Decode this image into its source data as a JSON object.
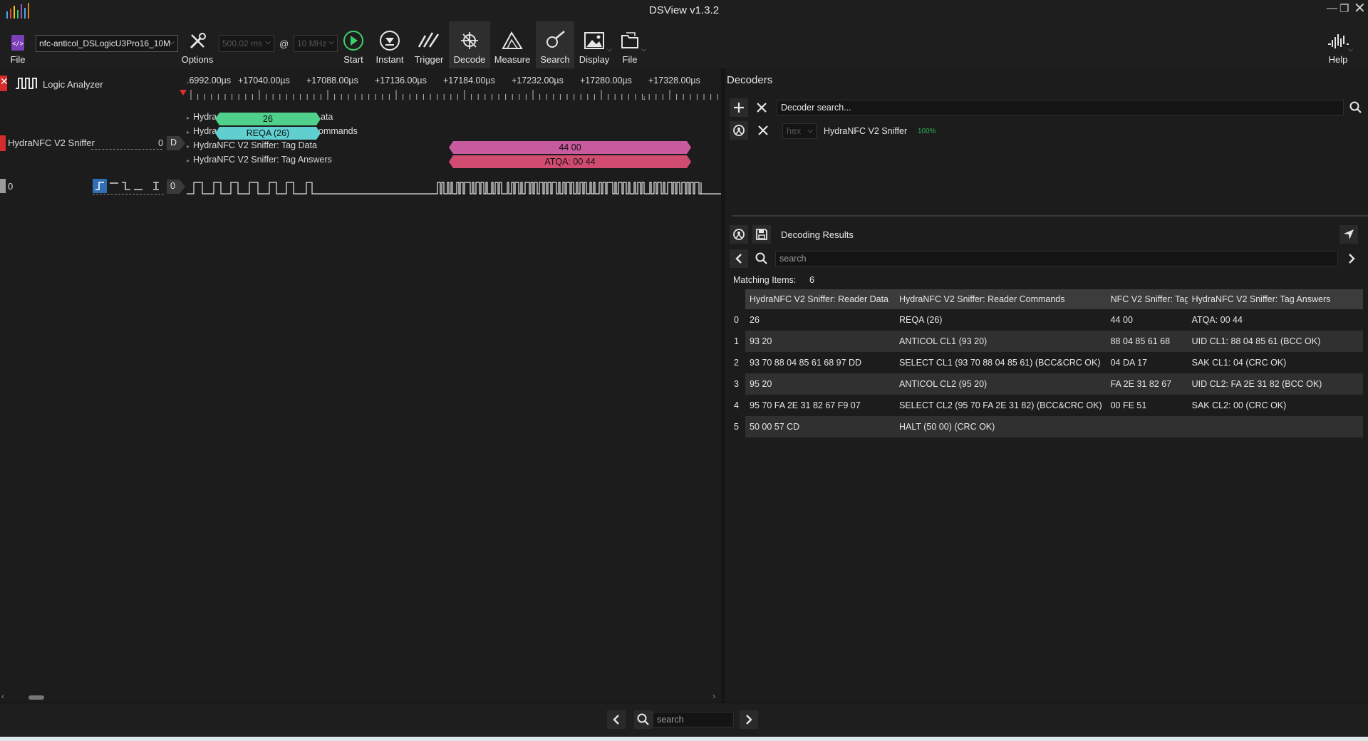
{
  "window": {
    "title": "DSView v1.3.2"
  },
  "toolbar": {
    "file_left_label": "File",
    "device_select": "nfc-anticol_DSLogicU3Pro16_10M",
    "options_label": "Options",
    "duration_select": "500.02 ms",
    "at_symbol": "@",
    "rate_select": "10 MHz",
    "start_label": "Start",
    "instant_label": "Instant",
    "trigger_label": "Trigger",
    "decode_label": "Decode",
    "measure_label": "Measure",
    "search_label": "Search",
    "display_label": "Display",
    "file_right_label": "File",
    "help_label": "Help"
  },
  "waveform": {
    "mode_label": "Logic Analyzer",
    "ruler_ticks": [
      ".6992.00µs",
      "+17040.00µs",
      "+17088.00µs",
      "+17136.00µs",
      "+17184.00µs",
      "+17232.00µs",
      "+17280.00µs",
      "+17328.00µs"
    ],
    "decoder_channel_label": "HydraNFC V2 Sniffer",
    "decoder_channel_index": "0",
    "decoder_badge": "D",
    "row_labels": {
      "reader_data_prefix": "Hydra",
      "reader_data_suffix": "ata",
      "reader_commands_prefix": "Hydra",
      "reader_commands_suffix": "ommands",
      "tag_data": "HydraNFC V2 Sniffer: Tag Data",
      "tag_answers": "HydraNFC V2 Sniffer: Tag Answers"
    },
    "annotations": {
      "reader_data": "26",
      "reader_command": "REQA (26)",
      "tag_data": "44 00",
      "tag_answer": "ATQA: 00 44"
    },
    "logic_channel_index": "0",
    "logic_channel_badge": "0",
    "colors": {
      "reader_data": "#4fd18b",
      "reader_command": "#5fcfcf",
      "tag_data": "#c85a9e",
      "tag_answer": "#d24c72"
    }
  },
  "decoders": {
    "title": "Decoders",
    "search_placeholder": "Decoder search...",
    "format_select": "hex",
    "decoder_name": "HydraNFC V2 Sniffer",
    "decoder_progress": "100%"
  },
  "results": {
    "title": "Decoding Results",
    "search_placeholder": "search",
    "matching_label": "Matching Items:",
    "matching_count": "6",
    "columns": [
      "HydraNFC V2 Sniffer: Reader Data",
      "HydraNFC V2 Sniffer: Reader Commands",
      "NFC V2 Sniffer: Tag",
      "HydraNFC V2 Sniffer: Tag Answers"
    ],
    "rows": [
      {
        "idx": "0",
        "reader_data": "26",
        "reader_cmd": "REQA (26)",
        "tag_data": "44 00",
        "tag_answer": "ATQA: 00 44"
      },
      {
        "idx": "1",
        "reader_data": "93 20",
        "reader_cmd": "ANTICOL CL1 (93 20)",
        "tag_data": "88 04 85 61 68",
        "tag_answer": "UID CL1: 88 04 85 61 (BCC OK)"
      },
      {
        "idx": "2",
        "reader_data": "93 70 88 04 85 61 68 97 DD",
        "reader_cmd": "SELECT CL1 (93 70 88 04 85 61) (BCC&CRC OK)",
        "tag_data": "04 DA 17",
        "tag_answer": "SAK CL1: 04 (CRC OK)"
      },
      {
        "idx": "3",
        "reader_data": "95 20",
        "reader_cmd": "ANTICOL CL2 (95 20)",
        "tag_data": "FA 2E 31 82 67",
        "tag_answer": "UID CL2: FA 2E 31 82 (BCC OK)"
      },
      {
        "idx": "4",
        "reader_data": "95 70 FA 2E 31 82 67 F9 07",
        "reader_cmd": "SELECT CL2 (95 70 FA 2E 31 82) (BCC&CRC OK)",
        "tag_data": "00 FE 51",
        "tag_answer": "SAK CL2: 00 (CRC OK)"
      },
      {
        "idx": "5",
        "reader_data": "50 00 57 CD",
        "reader_cmd": "HALT (50 00) (CRC OK)",
        "tag_data": "",
        "tag_answer": ""
      }
    ]
  },
  "bottom": {
    "search_placeholder": "search"
  }
}
